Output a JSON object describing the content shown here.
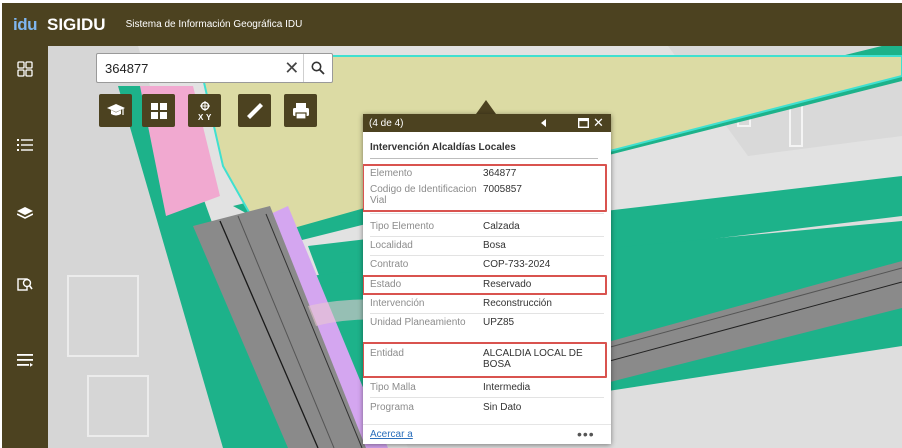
{
  "header": {
    "logo": "idu",
    "title": "SIGIDU",
    "subtitle": "Sistema de Información Geográfica IDU"
  },
  "sidebar": {
    "items": [
      {
        "icon": "widgets-grid-icon"
      },
      {
        "icon": "layer-list-icon"
      },
      {
        "icon": "layers-icon"
      },
      {
        "icon": "query-search-icon"
      },
      {
        "icon": "menu-icon"
      }
    ]
  },
  "search": {
    "value": "364877",
    "clear_icon": "close-icon",
    "go_icon": "search-icon"
  },
  "tools": [
    {
      "icon": "graduation-cap-icon"
    },
    {
      "icon": "basemap-grid-icon"
    },
    {
      "icon": "coordinates-xy-icon"
    },
    {
      "icon": "measure-ruler-icon"
    },
    {
      "icon": "print-icon"
    }
  ],
  "popup": {
    "counter": "(4 de 4)",
    "title": "Intervención Alcaldías Locales",
    "fields": [
      {
        "label": "Elemento",
        "value": "364877"
      },
      {
        "label": "Codigo de Identificacion Vial",
        "value": "7005857"
      },
      {
        "label": "Tipo Elemento",
        "value": "Calzada"
      },
      {
        "label": "Localidad",
        "value": "Bosa"
      },
      {
        "label": "Contrato",
        "value": "COP-733-2024"
      },
      {
        "label": "Estado",
        "value": "Reservado"
      },
      {
        "label": "Intervención",
        "value": "Reconstrucción"
      },
      {
        "label": "Unidad Planeamiento",
        "value": "UPZ85"
      },
      {
        "label": "Entidad",
        "value": "ALCALDIA LOCAL DE BOSA"
      },
      {
        "label": "Tipo Malla",
        "value": "Intermedia"
      },
      {
        "label": "Programa",
        "value": "Sin Dato"
      }
    ],
    "zoom_link": "Acercar a",
    "more": "•••"
  },
  "colors": {
    "chrome": "#4c4220",
    "highlight": "#d9534f",
    "link": "#2a6ebb",
    "map_green": "#1db28a",
    "map_pink": "#f1a9d0",
    "map_violet": "#d4a6f0",
    "map_khaki": "#dcdba4"
  }
}
